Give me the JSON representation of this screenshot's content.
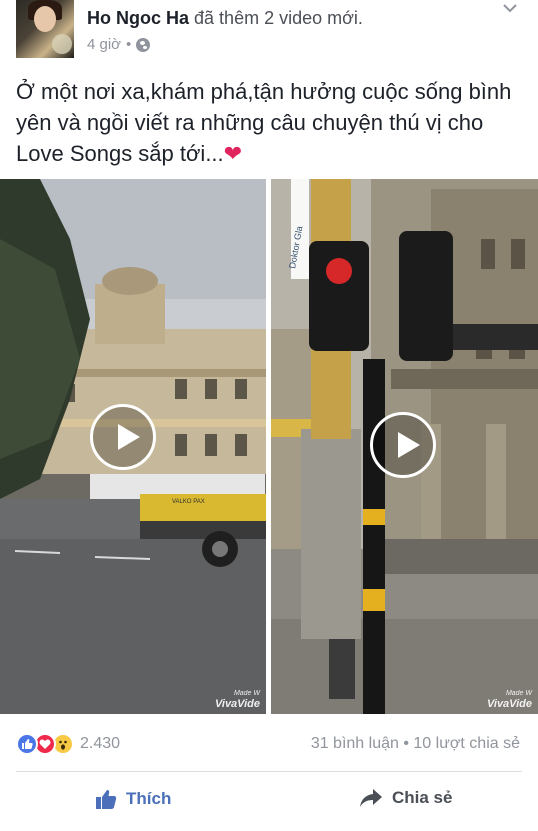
{
  "post": {
    "author": "Ho Ngoc Ha",
    "action": "đã thêm 2 video mới.",
    "time": "4 giờ",
    "separator": "•",
    "text": "Ở một nơi xa,khám phá,tận hưởng cuộc sống bình yên và ngồi viết ra những câu chuyện thú vị cho Love Songs sắp tới...",
    "emoji": "❤"
  },
  "videos": [
    {
      "watermark_small": "Made W",
      "watermark_big": "VivaVide",
      "truck_text": "VALKO PAX"
    },
    {
      "watermark_small": "Made W",
      "watermark_big": "VivaVide",
      "banner_text": "Doktor Gla"
    }
  ],
  "engagement": {
    "reaction_count": "2.430",
    "comments": "31 bình luận",
    "separator": "•",
    "shares": "10 lượt chia sẻ"
  },
  "buttons": {
    "like": "Thích",
    "share": "Chia sẻ"
  },
  "icons": {
    "menu": "chevron-down-icon",
    "privacy": "globe-icon",
    "like_reaction": "like-reaction-icon",
    "love_reaction": "love-reaction-icon",
    "wow_reaction": "wow-reaction-icon",
    "like_button": "thumbs-up-icon",
    "share_button": "share-arrow-icon",
    "play": "play-icon"
  },
  "colors": {
    "like_blue": "#4b6fb8",
    "meta_gray": "#90949c",
    "love_red": "#f0284a"
  }
}
